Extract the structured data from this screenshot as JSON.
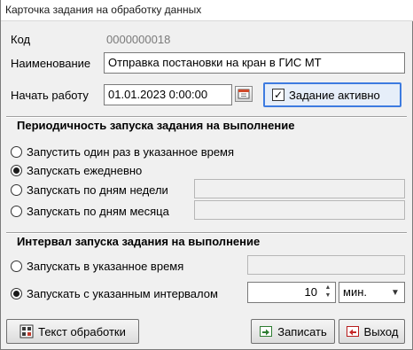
{
  "window": {
    "title": "Карточка задания на обработку данных"
  },
  "fields": {
    "code_label": "Код",
    "code_value": "0000000018",
    "name_label": "Наименование",
    "name_value": "Отправка постановки на кран в ГИС МТ",
    "start_label": "Начать работу",
    "start_value": "01.01.2023 0:00:00",
    "active_label": "Задание активно",
    "active_checked": true
  },
  "periodicity": {
    "title": "Периодичность запуска задания на выполнение",
    "options": [
      {
        "label": "Запустить один раз в указанное время",
        "checked": false
      },
      {
        "label": "Запускать ежедневно",
        "checked": true
      },
      {
        "label": "Запускать по дням недели",
        "checked": false,
        "value": ""
      },
      {
        "label": "Запускать по дням месяца",
        "checked": false,
        "value": ""
      }
    ]
  },
  "interval": {
    "title": "Интервал запуска задания на выполнение",
    "options": [
      {
        "label": "Запускать в указанное время",
        "checked": false,
        "value": ""
      },
      {
        "label": "Запускать с указанным интервалом",
        "checked": true
      }
    ],
    "interval_value": "10",
    "interval_unit": "мин."
  },
  "buttons": {
    "script": "Текст обработки",
    "save": "Записать",
    "exit": "Выход"
  }
}
